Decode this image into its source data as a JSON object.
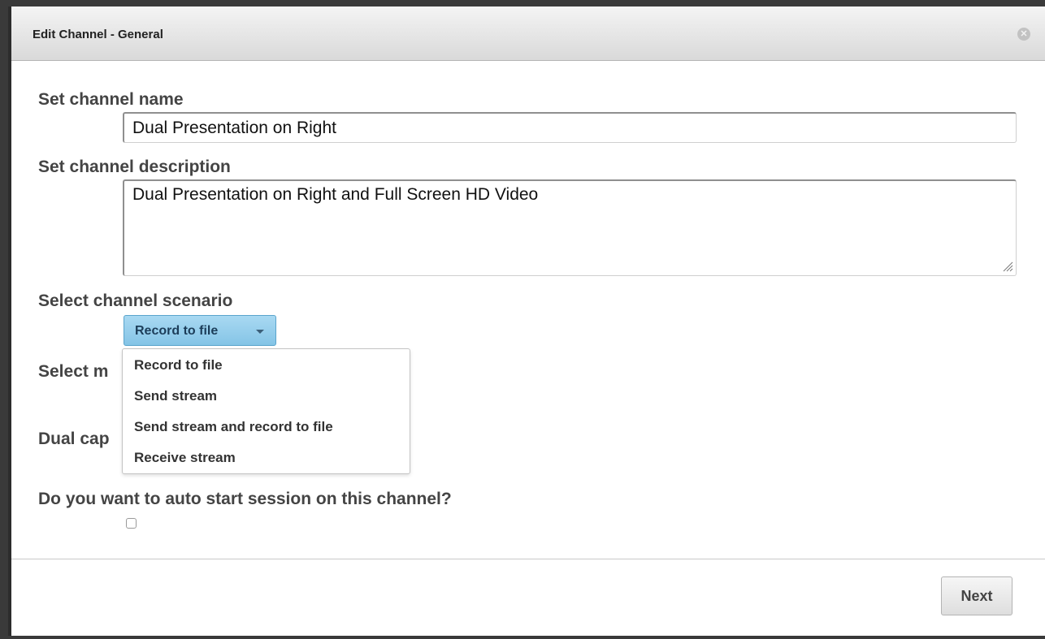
{
  "dialog": {
    "title": "Edit Channel - General",
    "close_icon": "close-circle-icon"
  },
  "channel_name": {
    "label": "Set channel name",
    "value": "Dual Presentation on Right"
  },
  "channel_description": {
    "label": "Set channel description",
    "value": "Dual Presentation on Right and Full Screen HD Video"
  },
  "scenario": {
    "label": "Select channel scenario",
    "selected": "Record to file",
    "options": [
      "Record to file",
      "Send stream",
      "Send stream and record to file",
      "Receive stream"
    ],
    "button_color": "#8ccbeb"
  },
  "partially_hidden_labels": {
    "select_m": "Select m",
    "dual_cap": "Dual cap"
  },
  "auto_start": {
    "label": "Do you want to auto start session on this channel?",
    "checked": false
  },
  "footer": {
    "next_label": "Next"
  }
}
